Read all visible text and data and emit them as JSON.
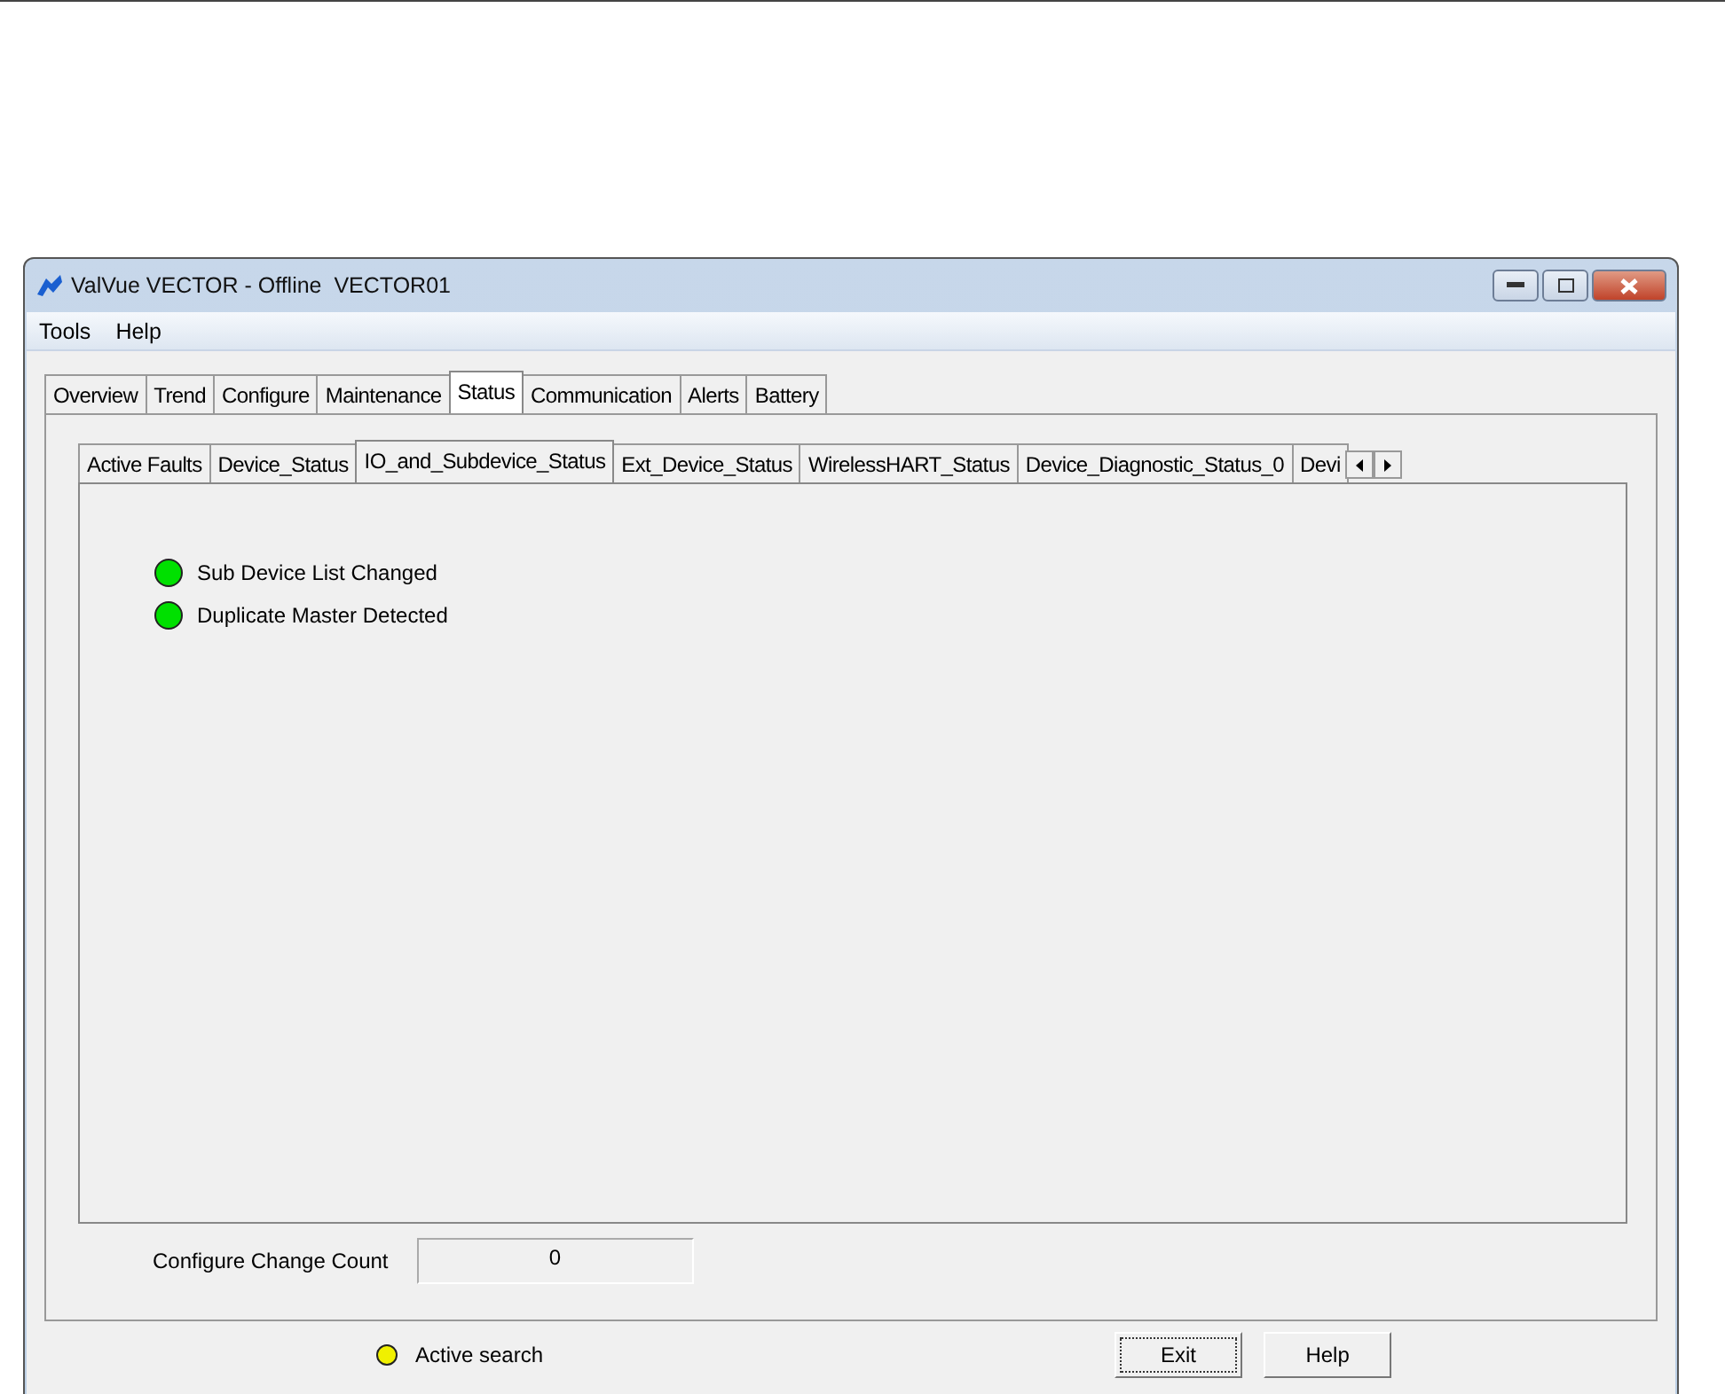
{
  "window": {
    "title": "ValVue VECTOR - Offline  VECTOR01"
  },
  "menu": [
    "Tools",
    "Help"
  ],
  "tabs": [
    {
      "label": "Overview",
      "selected": false
    },
    {
      "label": "Trend",
      "selected": false
    },
    {
      "label": "Configure",
      "selected": false
    },
    {
      "label": "Maintenance",
      "selected": false
    },
    {
      "label": "Status",
      "selected": true
    },
    {
      "label": "Communication",
      "selected": false
    },
    {
      "label": "Alerts",
      "selected": false
    },
    {
      "label": "Battery",
      "selected": false
    }
  ],
  "subtabs": [
    {
      "label": "Active Faults",
      "selected": false
    },
    {
      "label": "Device_Status",
      "selected": false
    },
    {
      "label": "IO_and_Subdevice_Status",
      "selected": true
    },
    {
      "label": "Ext_Device_Status",
      "selected": false
    },
    {
      "label": "WirelessHART_Status",
      "selected": false
    },
    {
      "label": "Device_Diagnostic_Status_0",
      "selected": false
    },
    {
      "label": "Devi",
      "selected": false
    }
  ],
  "indicators": [
    {
      "label": "Sub Device List Changed",
      "color": "#00e000"
    },
    {
      "label": "Duplicate Master Detected",
      "color": "#00e000"
    }
  ],
  "config_count": {
    "label": "Configure Change Count",
    "value": "0"
  },
  "status": {
    "label": "Active search",
    "color": "#f0f000"
  },
  "buttons": [
    {
      "label": "Exit",
      "focused": true
    },
    {
      "label": "Help",
      "focused": false
    }
  ]
}
